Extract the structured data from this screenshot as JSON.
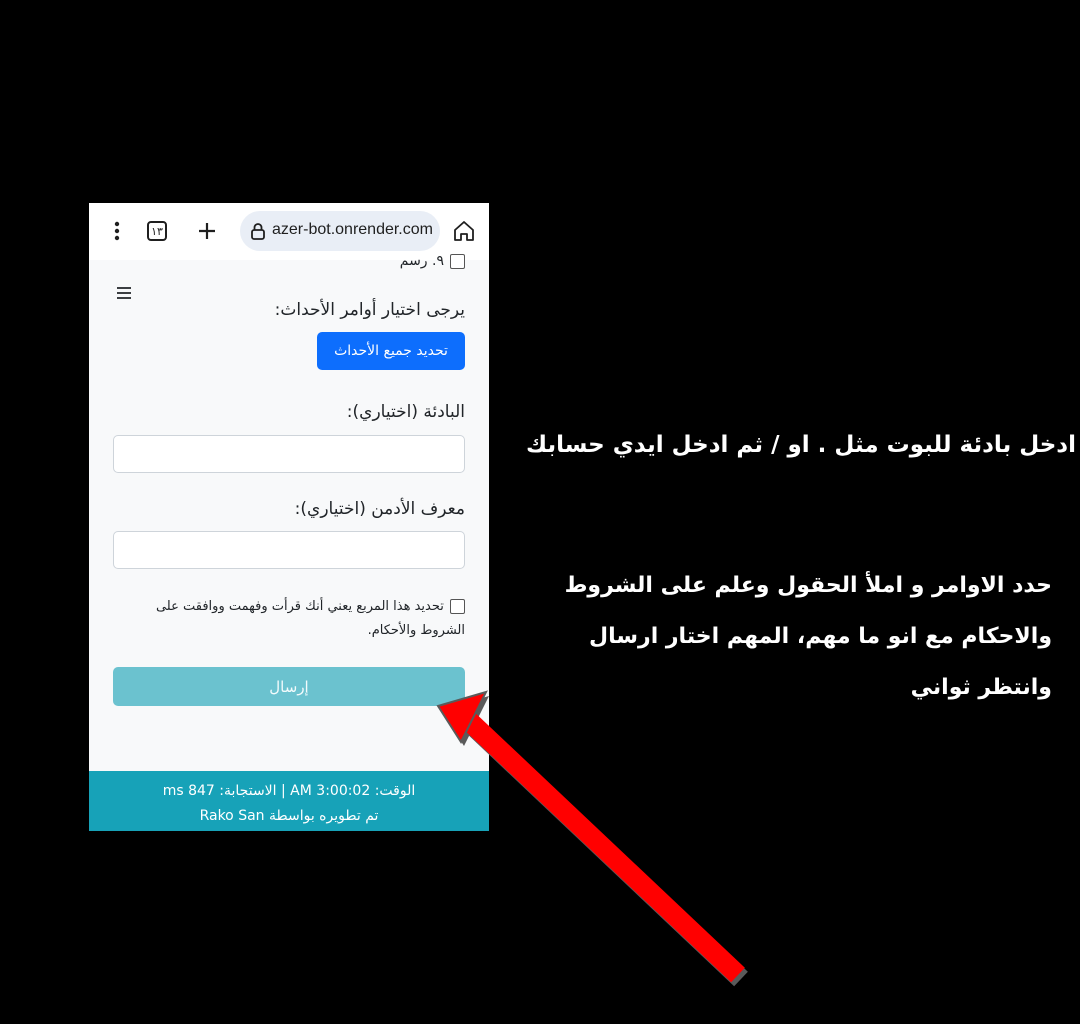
{
  "browser": {
    "tabs_count": "١٣",
    "url": "azer-bot.onrender.com"
  },
  "page": {
    "cut_off_item": "٩. رسم",
    "events_label": "يرجى اختيار أوامر الأحداث:",
    "select_all_button": "تحديد جميع الأحداث",
    "prefix_label": "البادئة (اختياري):",
    "prefix_value": "",
    "admin_id_label": "معرف الأدمن (اختياري):",
    "admin_id_value": "",
    "terms_text": "تحديد هذا المربع يعني أنك قرأت وفهمت ووافقت على الشروط والأحكام.",
    "submit_button": "إرسال"
  },
  "footer": {
    "time_line": "الوقت: 3:00:02 AM | الاستجابة: 847 ms",
    "credit_line": "تم تطويره بواسطة Rako San"
  },
  "annotations": {
    "line1": "ادخل بادئة للبوت مثل  .  او / ثم ادخل ايدي حسابك",
    "line2": "حدد الاوامر و املأ الحقول وعلم على الشروط",
    "line3": "والاحكام مع انو ما مهم، المهم اختار ارسال",
    "line4": "وانتظر ثواني"
  },
  "colors": {
    "primary_button": "#0d6efd",
    "submit_button": "#6bc2cf",
    "footer": "#17a2b8",
    "arrow": "#ff0000"
  }
}
